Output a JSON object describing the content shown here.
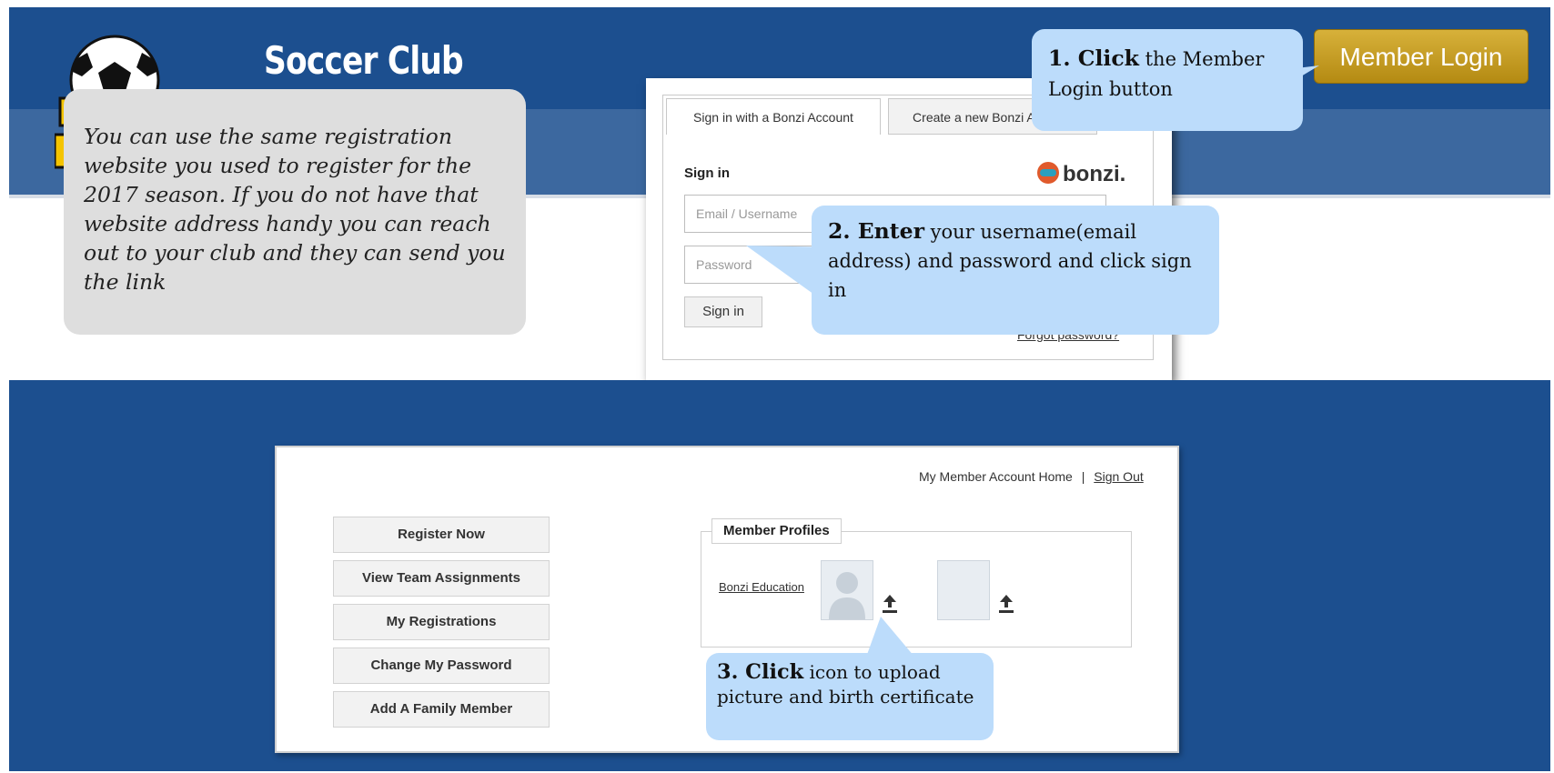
{
  "header": {
    "club_title": "Soccer Club",
    "member_login_label": "Member Login"
  },
  "info_callout": {
    "text": "You can use the same registration website you used to register for the 2017 season. If you do not have that website address handy you can reach out to your club and they can send you the link"
  },
  "step1": {
    "bold": "1. Click",
    "text": " the Member Login button"
  },
  "step2": {
    "bold": "2. Enter",
    "text": " your username(email address) and password and click sign in"
  },
  "step3": {
    "bold": "3. Click",
    "text": " icon to upload picture and birth certificate"
  },
  "signin": {
    "tab_signin": "Sign in with a Bonzi Account",
    "tab_create": "Create a new Bonzi Account",
    "heading": "Sign in",
    "brand": "bonzi.",
    "email_placeholder": "Email / Username",
    "password_placeholder": "Password",
    "signin_button": "Sign in",
    "forgot_link": "Forgot password?"
  },
  "account": {
    "home_link": "My Member Account Home",
    "separator": "|",
    "signout_link": "Sign Out",
    "menu": [
      "Register Now",
      "View Team Assignments",
      "My Registrations",
      "Change My Password",
      "Add A Family Member"
    ],
    "profiles_title": "Member Profiles",
    "profile_name": "Bonzi Education"
  },
  "colors": {
    "banner_blue": "#1c4f8f",
    "banner_light_blue": "#3c689f",
    "callout_blue": "#bcdcfb",
    "callout_gray": "#dedede",
    "login_gold": "#c79f22"
  }
}
